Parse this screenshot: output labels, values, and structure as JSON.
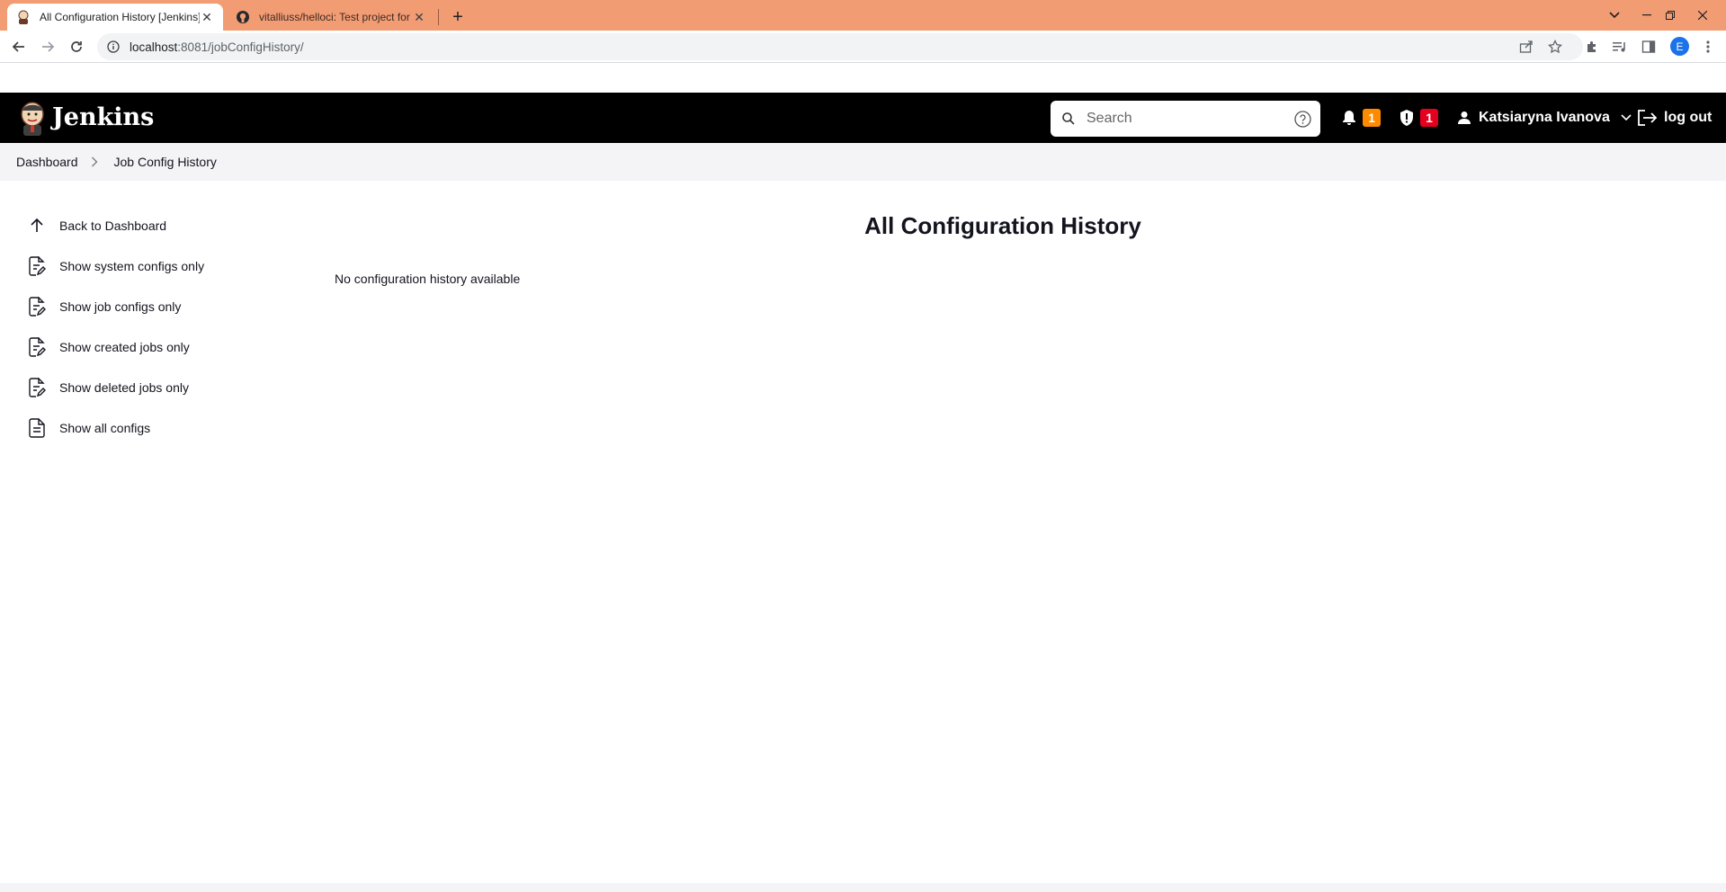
{
  "browser": {
    "tabs": [
      {
        "title": "All Configuration History [Jenkins]",
        "active": true
      },
      {
        "title": "vitalliuss/helloci: Test project for",
        "active": false
      }
    ],
    "url_host": "localhost",
    "url_path": ":8081/jobConfigHistory/",
    "profile_initial": "E",
    "tab_bar_color": "#f29c74"
  },
  "header": {
    "title": "Jenkins",
    "search_placeholder": "Search",
    "notifications_count": "1",
    "security_count": "1",
    "user_name": "Katsiaryna Ivanova",
    "logout_label": "log out"
  },
  "breadcrumb": {
    "items": [
      "Dashboard",
      "Job Config History"
    ]
  },
  "sidebar": {
    "items": [
      {
        "label": "Back to Dashboard",
        "icon": "arrow-up-icon"
      },
      {
        "label": "Show system configs only",
        "icon": "document-edit-icon"
      },
      {
        "label": "Show job configs only",
        "icon": "document-edit-icon"
      },
      {
        "label": "Show created jobs only",
        "icon": "document-edit-icon"
      },
      {
        "label": "Show deleted jobs only",
        "icon": "document-edit-icon"
      },
      {
        "label": "Show all configs",
        "icon": "document-icon"
      }
    ]
  },
  "main": {
    "title": "All Configuration History",
    "empty_message": "No configuration history available"
  },
  "colors": {
    "header_bg": "#000000",
    "badge_orange": "#fe8a00",
    "badge_red": "#e6001f",
    "breadcrumb_bg": "#f4f4f6"
  }
}
